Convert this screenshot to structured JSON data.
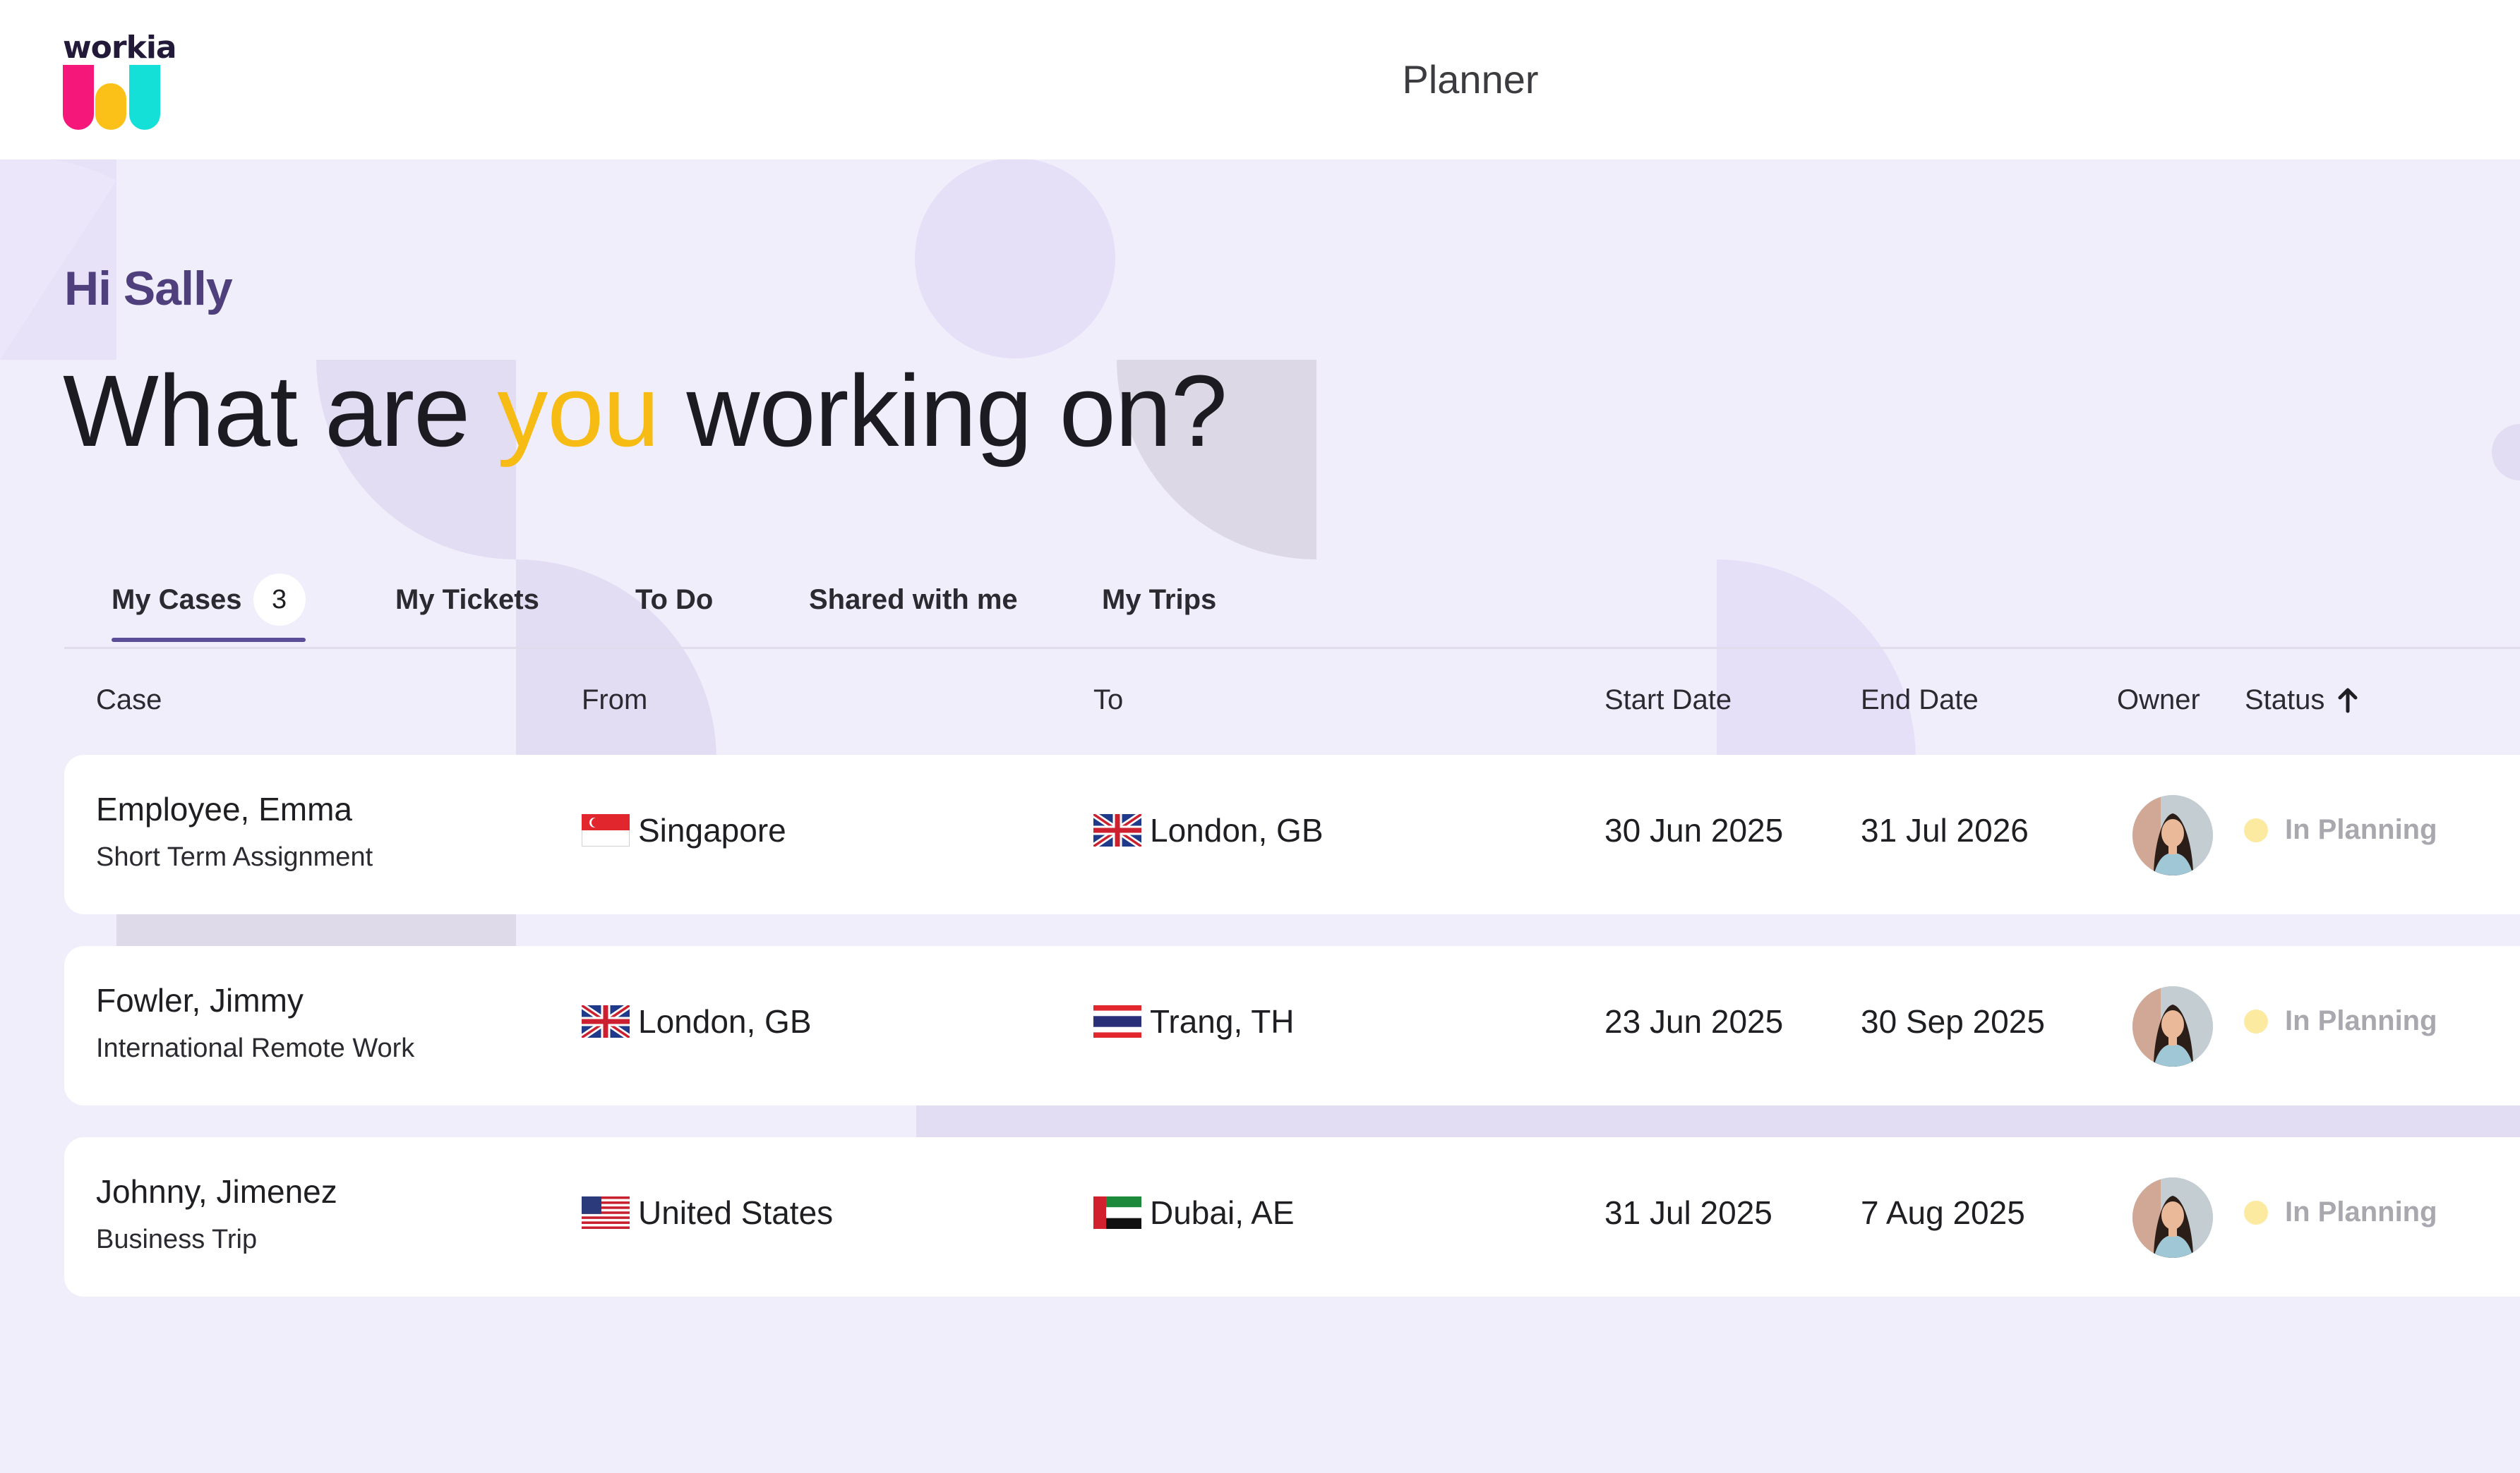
{
  "header": {
    "brand": "workia",
    "title": "Planner"
  },
  "greeting": "Hi Sally",
  "headline": {
    "before": "What are",
    "accent": "you",
    "after": "working on?"
  },
  "tabs": [
    {
      "label": "My Cases",
      "badge": "3",
      "active": true
    },
    {
      "label": "My Tickets"
    },
    {
      "label": "To Do"
    },
    {
      "label": "Shared with me"
    },
    {
      "label": "My Trips"
    }
  ],
  "table": {
    "columns": [
      "Case",
      "From",
      "To",
      "Start Date",
      "End Date",
      "Owner",
      "Status"
    ],
    "sort": {
      "column": "Status",
      "direction": "ascending",
      "icon": "arrow-up-icon"
    },
    "rows": [
      {
        "name": "Employee, Emma",
        "type": "Short Term Assignment",
        "from": {
          "label": "Singapore",
          "flag": "singapore-flag-icon"
        },
        "to": {
          "label": "London, GB",
          "flag": "uk-flag-icon"
        },
        "start": "30 Jun 2025",
        "end": "31 Jul 2026",
        "owner_avatar": "owner-avatar",
        "status": "In Planning"
      },
      {
        "name": "Fowler, Jimmy",
        "type": "International Remote Work",
        "from": {
          "label": "London, GB",
          "flag": "uk-flag-icon"
        },
        "to": {
          "label": "Trang, TH",
          "flag": "thailand-flag-icon"
        },
        "start": "23 Jun 2025",
        "end": "30 Sep 2025",
        "owner_avatar": "owner-avatar",
        "status": "In Planning"
      },
      {
        "name": "Johnny, Jimenez",
        "type": "Business Trip",
        "from": {
          "label": "United States",
          "flag": "usa-flag-icon"
        },
        "to": {
          "label": "Dubai, AE",
          "flag": "uae-flag-icon"
        },
        "start": "31 Jul 2025",
        "end": "7 Aug 2025",
        "owner_avatar": "owner-avatar",
        "status": "In Planning"
      }
    ]
  },
  "colors": {
    "background": "#f1eefc",
    "accent_yellow": "#f6bc14",
    "greeting_purple": "#4f3f7c",
    "tab_underline": "#5b4d98",
    "status_dot": "#fbeaa0",
    "logo_pink": "#f5177a",
    "logo_yellow": "#fbc119",
    "logo_cyan": "#15e0d8"
  }
}
